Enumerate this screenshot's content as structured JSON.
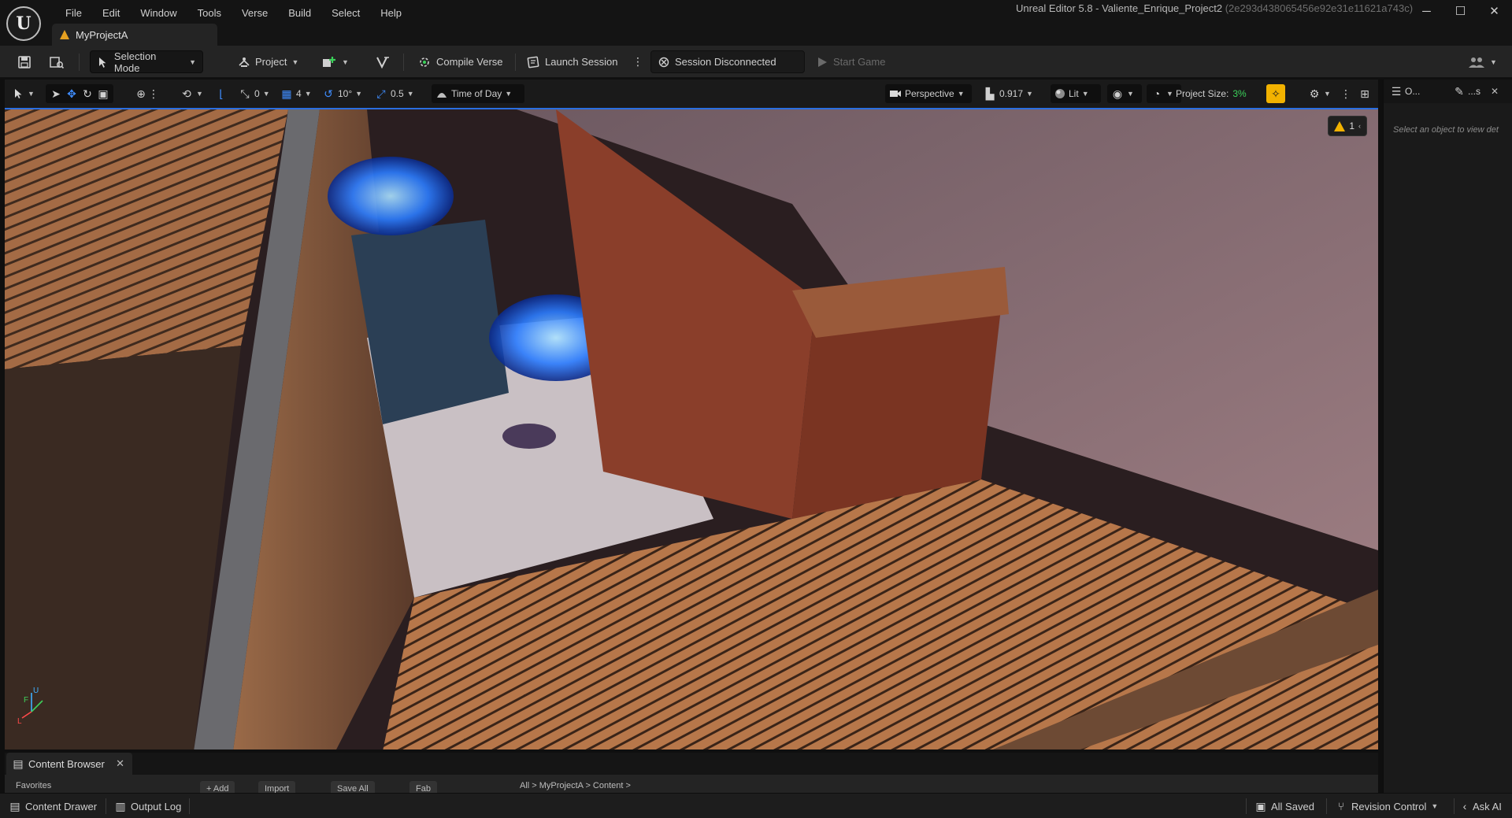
{
  "menu": [
    "File",
    "Edit",
    "Window",
    "Tools",
    "Verse",
    "Build",
    "Select",
    "Help"
  ],
  "window": {
    "title": "Unreal Editor 5.8 - Valiente_Enrique_Project2",
    "hash": "(2e293d438065456e92e31e11621a743c)",
    "minimize": "─",
    "maximize": "☐",
    "close": "✕"
  },
  "project_tab": {
    "label": "MyProjectA"
  },
  "toolbar": {
    "selection_mode": "Selection Mode",
    "project": "Project",
    "compile_verse": "Compile Verse",
    "launch_session": "Launch Session",
    "session_status": "Session Disconnected",
    "start_game": "Start Game"
  },
  "viewport_toolbar": {
    "rotation_snap": "0",
    "grid_snap": "4",
    "angle_snap": "10°",
    "scale_snap": "0.5",
    "time_of_day": "Time of Day",
    "perspective": "Perspective",
    "camera_speed": "0.917",
    "view_mode": "Lit",
    "project_size_label": "Project Size:",
    "project_size_value": "3%"
  },
  "viewport": {
    "warning_count": "1",
    "axis_labels": {
      "z": "U",
      "x": "F",
      "y": "L"
    }
  },
  "right_panel": {
    "tab1": "O...",
    "tab2": "...s",
    "empty_message": "Select an object to view det"
  },
  "content_browser": {
    "tab_label": "Content Browser",
    "chips": [
      "+ Add",
      "Import",
      "Save All",
      "Fab"
    ],
    "favorites": "Favorites",
    "path": "All  >  MyProjectA  >  Content  >"
  },
  "statusbar": {
    "content_drawer": "Content Drawer",
    "output_log": "Output Log",
    "all_saved": "All Saved",
    "revision_control": "Revision Control",
    "ask_ai": "Ask AI"
  },
  "colors": {
    "accent_blue": "#2a6ee0",
    "project_size_green": "#3bd15a",
    "warning_yellow": "#f2b200",
    "realtime_yellow": "#f2b200"
  }
}
